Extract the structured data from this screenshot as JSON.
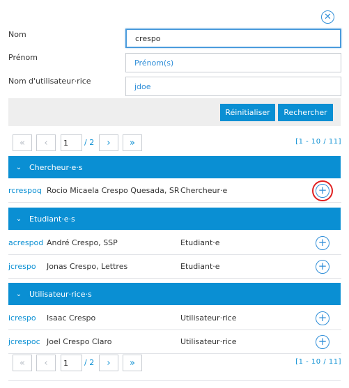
{
  "close_icon": "✕",
  "form": {
    "nom": {
      "label": "Nom",
      "value": "crespo",
      "placeholder": ""
    },
    "prenom": {
      "label": "Prénom",
      "value": "",
      "placeholder": "Prénom(s)"
    },
    "username": {
      "label": "Nom d'utilisateur·rice",
      "value": "",
      "placeholder": "jdoe"
    }
  },
  "actions": {
    "reset": "Réinitialiser",
    "search": "Rechercher"
  },
  "pager": {
    "first_icon": "«",
    "prev_icon": "‹",
    "next_icon": "›",
    "last_icon": "»",
    "page": "1",
    "total": "/ 2",
    "range": "[1 - 10 / 11]"
  },
  "groups": [
    {
      "title": "Chercheur·e·s",
      "chevron": "⌄",
      "rows": [
        {
          "login": "rcrespoq",
          "name": "Rocio Micaela Crespo Quesada, SR",
          "type": "Chercheur·e"
        }
      ]
    },
    {
      "title": "Etudiant·e·s",
      "chevron": "⌄",
      "rows": [
        {
          "login": "acrespod",
          "name": "André Crespo, SSP",
          "type": "Etudiant·e"
        },
        {
          "login": "jcrespo",
          "name": "Jonas Crespo, Lettres",
          "type": "Etudiant·e"
        }
      ]
    },
    {
      "title": "Utilisateur·rice·s",
      "chevron": "⌄",
      "rows": [
        {
          "login": "icrespo",
          "name": "Isaac Crespo",
          "type": "Utilisateur·rice"
        },
        {
          "login": "jcrespoc",
          "name": "Joel Crespo Claro",
          "type": "Utilisateur·rice"
        }
      ]
    }
  ],
  "add_icon": "+",
  "colors": {
    "accent": "#0a8fd3",
    "highlight": "#e02020",
    "bar": "#eeeeee"
  }
}
